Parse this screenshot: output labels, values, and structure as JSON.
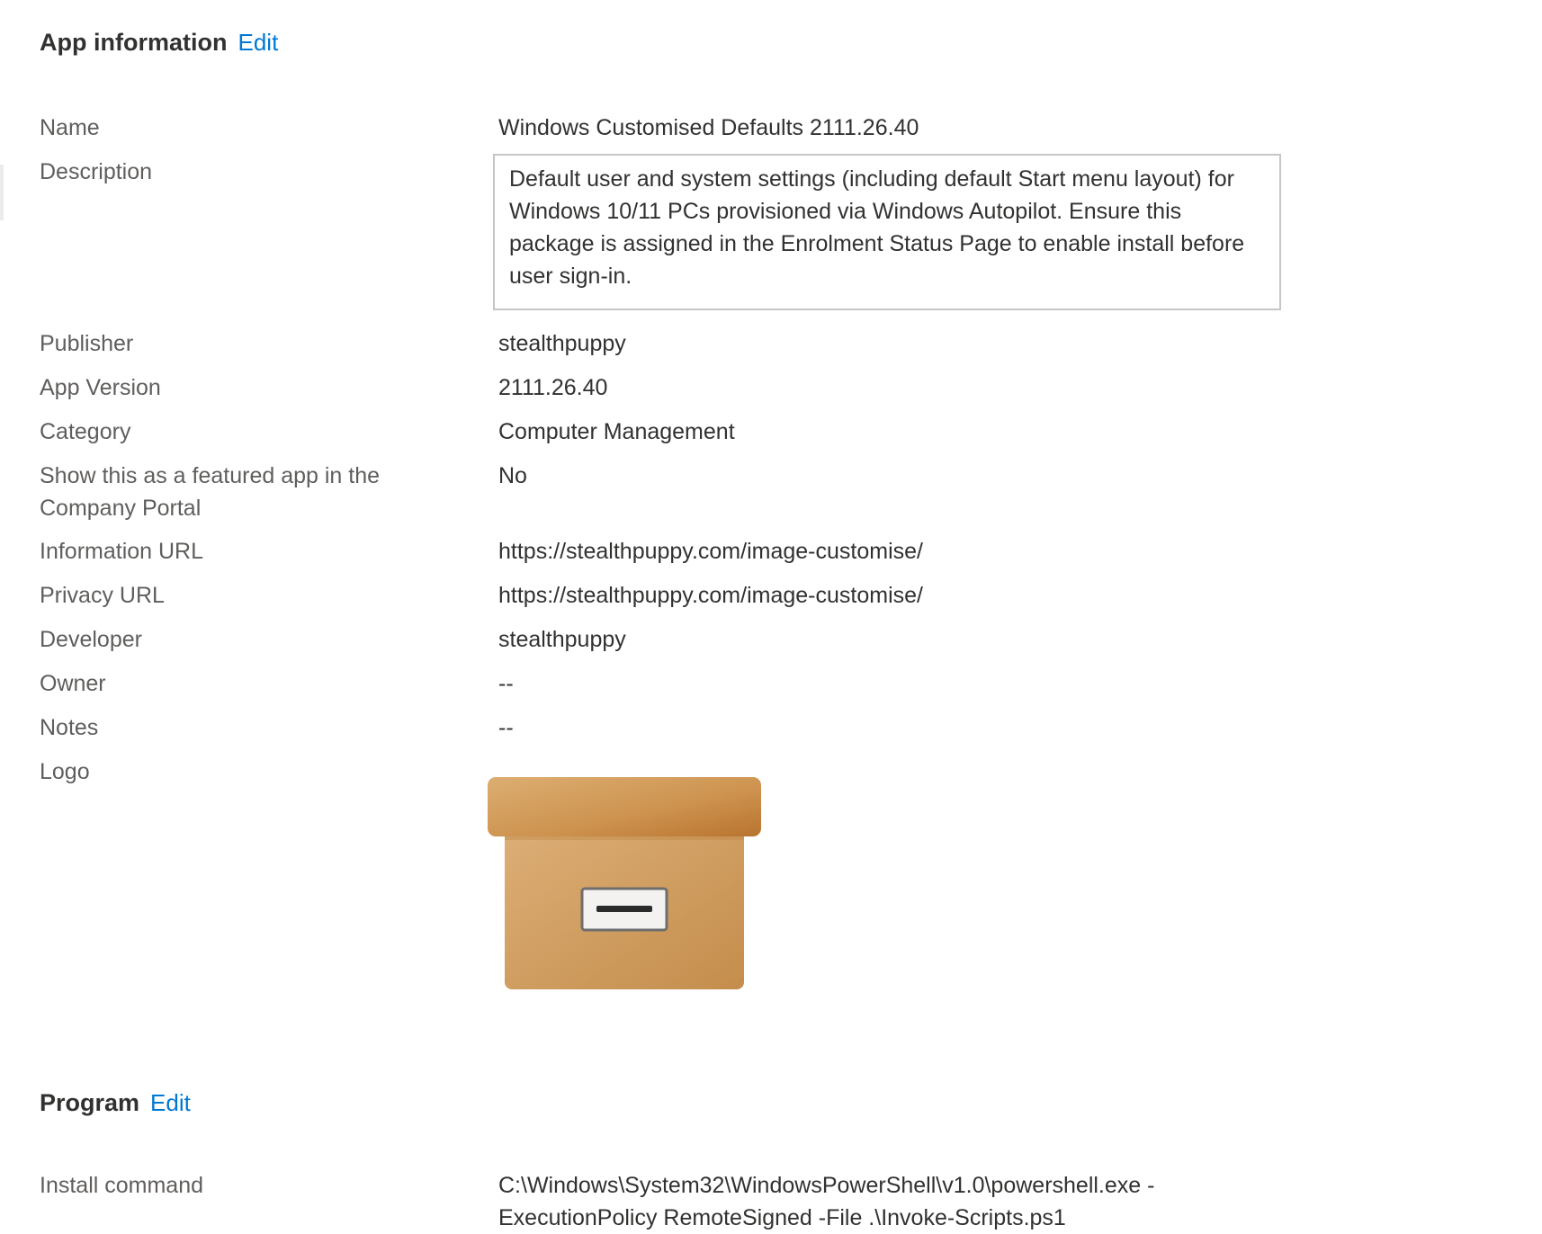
{
  "app_information": {
    "title": "App information",
    "edit_label": "Edit",
    "fields": {
      "name": {
        "label": "Name",
        "value": "Windows Customised Defaults 2111.26.40"
      },
      "description": {
        "label": "Description",
        "value": "Default user and system settings (including default Start menu layout) for Windows 10/11 PCs provisioned via Windows Autopilot. Ensure this package is assigned in the Enrolment Status Page to enable install before user sign-in."
      },
      "publisher": {
        "label": "Publisher",
        "value": "stealthpuppy"
      },
      "app_version": {
        "label": "App Version",
        "value": "2111.26.40"
      },
      "category": {
        "label": "Category",
        "value": "Computer Management"
      },
      "featured": {
        "label": "Show this as a featured app in the Company Portal",
        "value": "No"
      },
      "information_url": {
        "label": "Information URL",
        "value": "https://stealthpuppy.com/image-customise/"
      },
      "privacy_url": {
        "label": "Privacy URL",
        "value": "https://stealthpuppy.com/image-customise/"
      },
      "developer": {
        "label": "Developer",
        "value": "stealthpuppy"
      },
      "owner": {
        "label": "Owner",
        "value": "--"
      },
      "notes": {
        "label": "Notes",
        "value": "--"
      },
      "logo": {
        "label": "Logo",
        "icon": "archive-box-icon"
      }
    }
  },
  "program": {
    "title": "Program",
    "edit_label": "Edit",
    "fields": {
      "install_command": {
        "label": "Install command",
        "value": "C:\\Windows\\System32\\WindowsPowerShell\\v1.0\\powershell.exe -ExecutionPolicy RemoteSigned -File .\\Invoke-Scripts.ps1"
      }
    }
  },
  "colors": {
    "accent": "#0078d4",
    "label_text": "#605e5c",
    "value_text": "#323130",
    "box_border": "#c8c6c4"
  }
}
